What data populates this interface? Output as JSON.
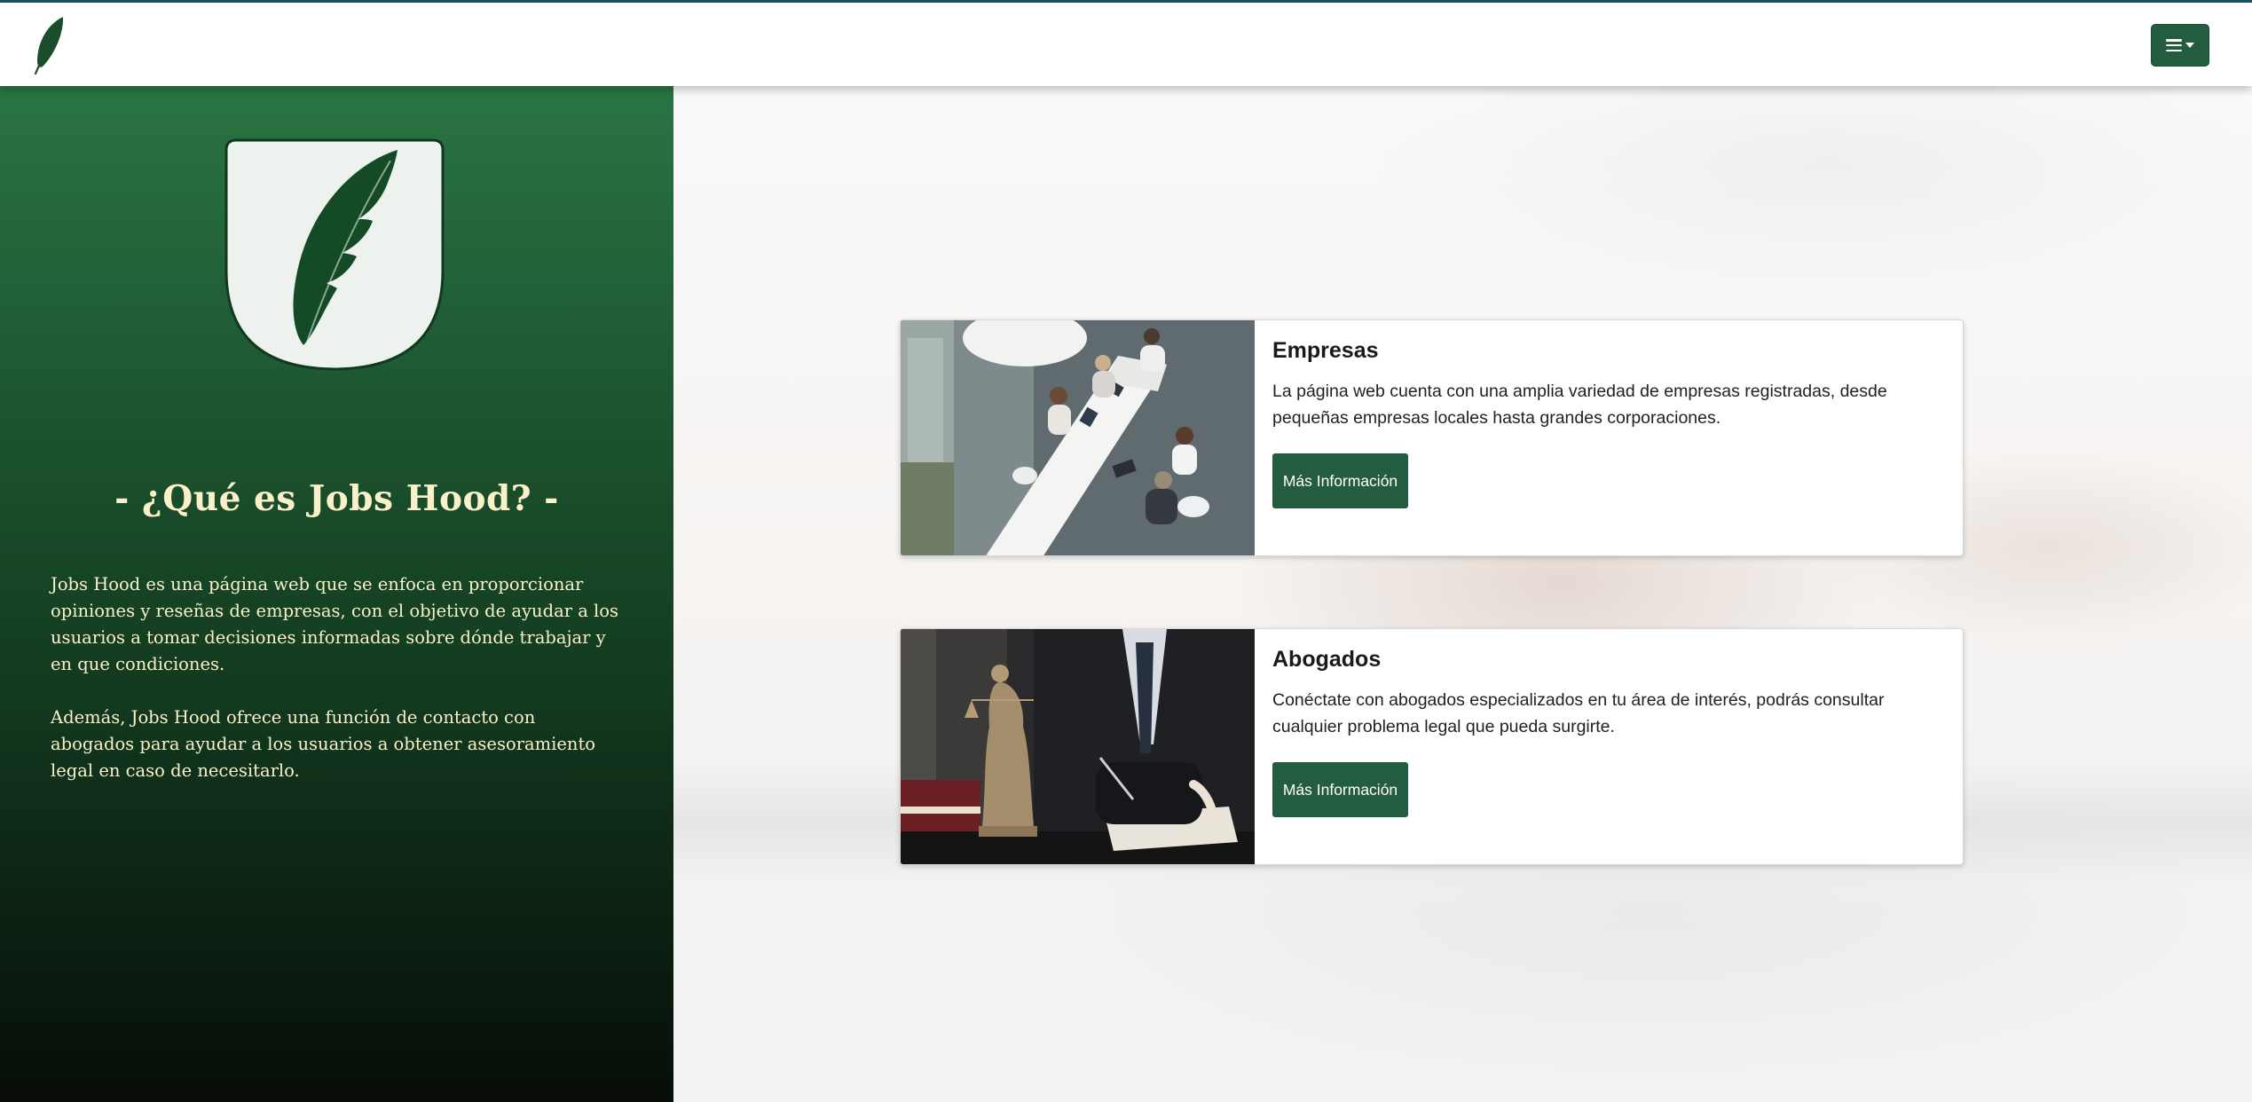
{
  "navbar": {
    "logo_icon": "feather-icon",
    "menu_icon": "hamburger-menu-icon"
  },
  "sidebar": {
    "crest_icon": "feather-shield-icon",
    "title": "- ¿Qué es Jobs Hood? -",
    "paragraphs": [
      "Jobs Hood es una página web que se enfoca en proporcionar opiniones y reseñas de empresas, con el objetivo de ayudar a los usuarios a tomar decisiones informadas sobre dónde trabajar y en que condiciones.",
      "Además, Jobs Hood ofrece una función de contacto con abogados para ayudar a los usuarios a obtener asesoramiento legal en caso de necesitarlo."
    ]
  },
  "cards": [
    {
      "title": "Empresas",
      "text": "La página web cuenta con una amplia variedad de empresas registradas, desde pequeñas empresas locales hasta grandes corporaciones.",
      "button_label": "Más Información",
      "image": "business-meeting-photo"
    },
    {
      "title": "Abogados",
      "text": "Conéctate con abogados especializados en tu área de interés, podrás consultar cualquier problema legal que pueda surgirte.",
      "button_label": "Más Información",
      "image": "lawyer-justice-statue-photo"
    }
  ],
  "colors": {
    "brand_green": "#245c40",
    "sidebar_green": "#2a7443",
    "sidebar_text": "#fbf1c9"
  }
}
